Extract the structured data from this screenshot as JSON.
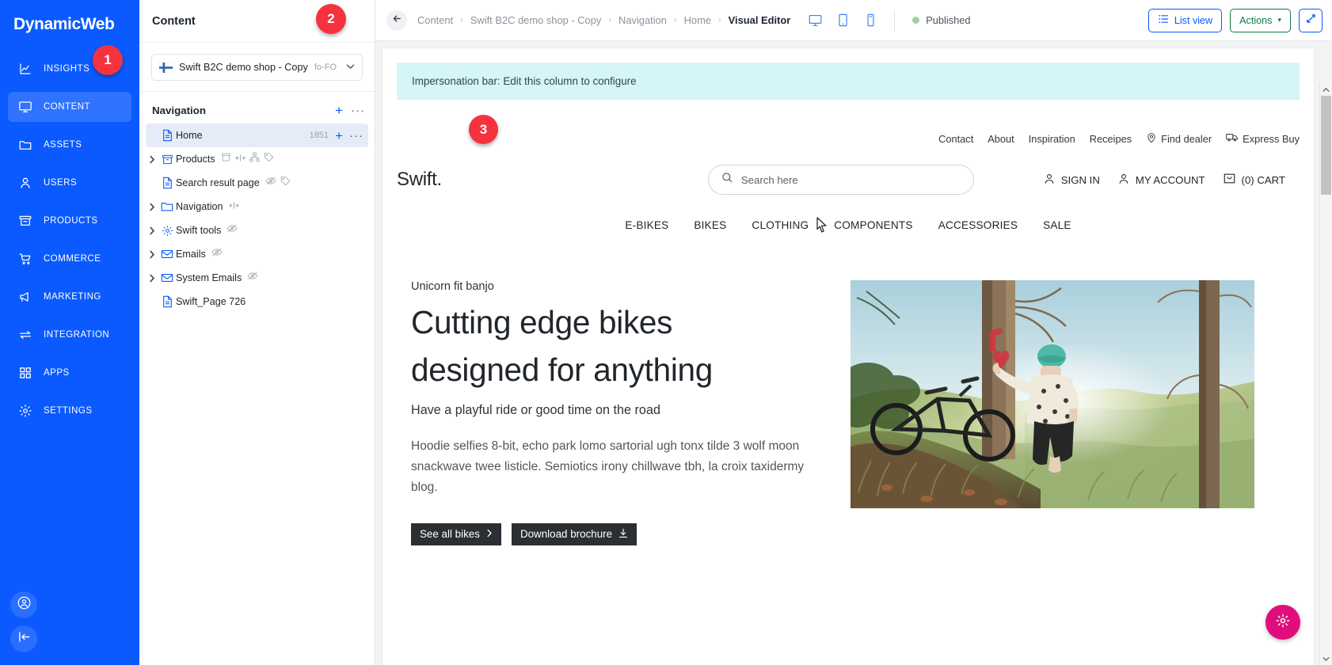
{
  "leftnav": {
    "brand": "DynamicWeb",
    "items": [
      {
        "label": "INSIGHTS",
        "icon": "chart-line-icon"
      },
      {
        "label": "CONTENT",
        "icon": "monitor-icon"
      },
      {
        "label": "ASSETS",
        "icon": "folder-icon"
      },
      {
        "label": "USERS",
        "icon": "user-icon"
      },
      {
        "label": "PRODUCTS",
        "icon": "archive-box-icon"
      },
      {
        "label": "COMMERCE",
        "icon": "shopping-cart-icon"
      },
      {
        "label": "MARKETING",
        "icon": "megaphone-icon"
      },
      {
        "label": "INTEGRATION",
        "icon": "arrows-exchange-icon"
      },
      {
        "label": "APPS",
        "icon": "grid-apps-icon"
      },
      {
        "label": "SETTINGS",
        "icon": "gear-icon"
      }
    ],
    "bottom": [
      {
        "icon": "account-circle-icon"
      },
      {
        "icon": "collapse-panel-icon"
      }
    ],
    "accent": "#0a5aff",
    "active_index": 1
  },
  "content_panel": {
    "title": "Content",
    "site_selector": {
      "name": "Swift B2C demo shop - Copy",
      "code": "fo-FO",
      "flag": "faroe-islands-flag-icon",
      "chevron": "chevron-down-icon"
    },
    "nav_section": {
      "title": "Navigation",
      "add_label": "+",
      "more_label": "···"
    },
    "tree": [
      {
        "label": "Home",
        "icon": "page-icon",
        "caret": false,
        "selected": true,
        "count": "1851",
        "badges": [],
        "row_actions": [
          "+",
          "···"
        ]
      },
      {
        "label": "Products",
        "icon": "archive-box-icon",
        "caret": true,
        "selected": false,
        "count": "",
        "badges": [
          "archive-box-icon",
          "navigation-arrows-icon",
          "sitemap-icon",
          "tag-icon"
        ],
        "row_actions": []
      },
      {
        "label": "Search result page",
        "icon": "page-icon",
        "caret": false,
        "selected": false,
        "count": "",
        "badges": [
          "hidden-eye-icon",
          "tag-icon"
        ],
        "row_actions": []
      },
      {
        "label": "Navigation",
        "icon": "folder-icon",
        "caret": true,
        "selected": false,
        "count": "",
        "badges": [
          "navigation-arrows-icon"
        ],
        "row_actions": []
      },
      {
        "label": "Swift tools",
        "icon": "gear-icon",
        "caret": true,
        "selected": false,
        "count": "",
        "badges": [
          "hidden-eye-icon"
        ],
        "row_actions": []
      },
      {
        "label": "Emails",
        "icon": "envelope-icon",
        "caret": true,
        "selected": false,
        "count": "",
        "badges": [
          "hidden-eye-icon"
        ],
        "row_actions": []
      },
      {
        "label": "System Emails",
        "icon": "envelope-icon",
        "caret": true,
        "selected": false,
        "count": "",
        "badges": [
          "hidden-eye-icon"
        ],
        "row_actions": []
      },
      {
        "label": "Swift_Page 726",
        "icon": "page-icon",
        "caret": false,
        "selected": false,
        "count": "",
        "badges": [],
        "row_actions": []
      }
    ]
  },
  "topbar": {
    "back_icon": "arrow-left-icon",
    "breadcrumbs": [
      {
        "label": "Content",
        "current": false
      },
      {
        "label": "Swift B2C demo shop - Copy",
        "current": false
      },
      {
        "label": "Navigation",
        "current": false
      },
      {
        "label": "Home",
        "current": false
      },
      {
        "label": "Visual Editor",
        "current": true
      }
    ],
    "separator": "›",
    "devices": [
      {
        "icon": "desktop-icon",
        "active": true
      },
      {
        "icon": "tablet-icon",
        "active": false
      },
      {
        "icon": "mobile-icon",
        "active": false
      }
    ],
    "status": {
      "label": "Published",
      "color": "#9ad49a"
    },
    "list_view_label": "List view",
    "list_view_icon": "list-icon",
    "actions_label": "Actions",
    "actions_caret": "▾",
    "expand_icon": "expand-diagonal-icon",
    "accent_blue": "#0a5aff",
    "accent_green": "#107a46"
  },
  "preview": {
    "impersonation_bar": "Impersonation bar: Edit this column to configure",
    "util_nav": [
      {
        "label": "Contact",
        "icon": ""
      },
      {
        "label": "About",
        "icon": ""
      },
      {
        "label": "Inspiration",
        "icon": ""
      },
      {
        "label": "Receipes",
        "icon": ""
      },
      {
        "label": "Find dealer",
        "icon": "location-pin-icon"
      },
      {
        "label": "Express Buy",
        "icon": "truck-icon"
      }
    ],
    "logo": "Swift.",
    "search_placeholder": "Search here",
    "search_icon": "search-icon",
    "account_links": [
      {
        "label": "SIGN IN",
        "icon": "user-icon"
      },
      {
        "label": "MY ACCOUNT",
        "icon": "user-icon"
      },
      {
        "label": "(0) CART",
        "icon": "bag-icon"
      }
    ],
    "main_nav": [
      "E-BIKES",
      "BIKES",
      "CLOTHING",
      "COMPONENTS",
      "ACCESSORIES",
      "SALE"
    ],
    "hero": {
      "eyebrow": "Unicorn fit banjo",
      "heading_line1": "Cutting edge bikes",
      "heading_line2": "designed for anything",
      "subheading": "Have a playful ride or good time on the road",
      "body": "Hoodie selfies 8-bit, echo park lomo sartorial ugh tonx tilde 3 wolf moon snackwave twee listicle. Semiotics irony chillwave tbh, la croix taxidermy blog.",
      "buttons": [
        {
          "label": "See all bikes",
          "icon": "chevron-right-icon"
        },
        {
          "label": "Download brochure",
          "icon": "download-icon"
        }
      ],
      "image_alt": "mountain-biker-forest-photo"
    }
  },
  "overlays": {
    "badges": [
      {
        "number": "1"
      },
      {
        "number": "2"
      },
      {
        "number": "3"
      }
    ],
    "badge_color": "#f5333f",
    "fab": {
      "icon": "gear-icon",
      "color": "#e20d7c"
    }
  },
  "scrollbar": {
    "up_arrow": "chevron-up-icon",
    "down_arrow": "chevron-down-icon"
  }
}
